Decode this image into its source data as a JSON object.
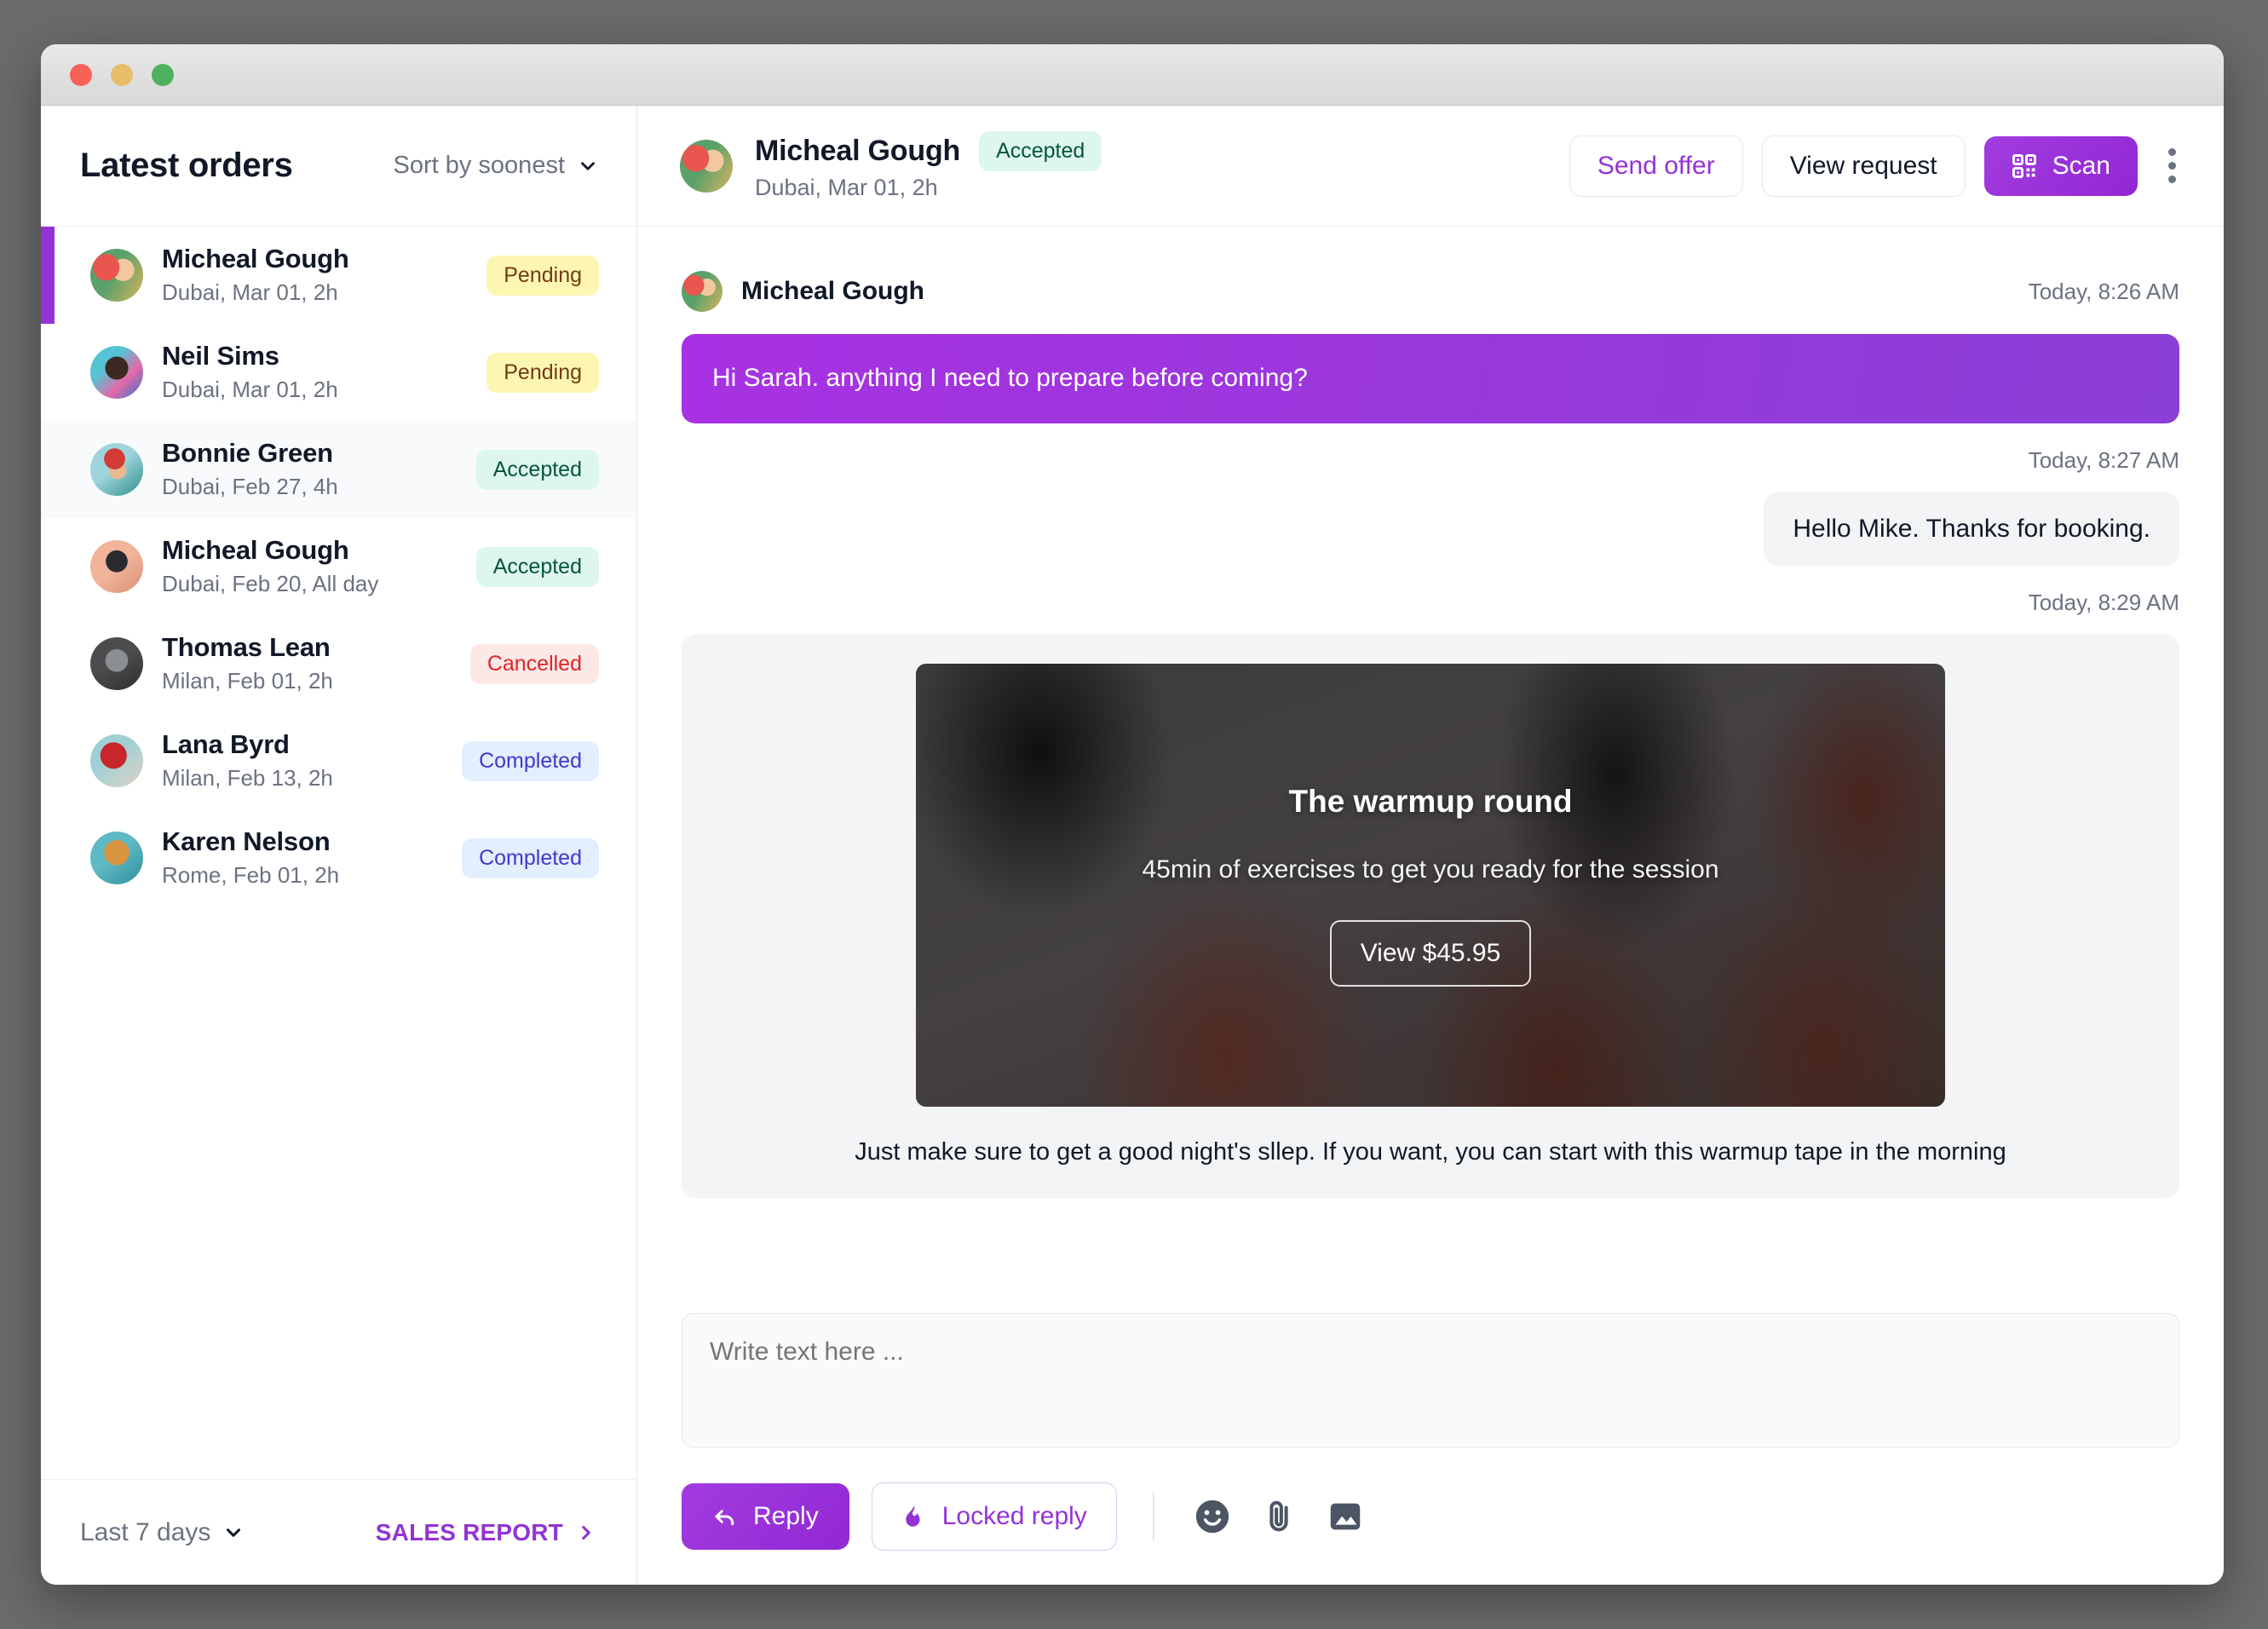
{
  "window": {
    "traffic_lights": [
      "close",
      "minimize",
      "maximize"
    ]
  },
  "sidebar": {
    "title": "Latest orders",
    "sort_label": "Sort by soonest",
    "orders": [
      {
        "name": "Micheal Gough",
        "meta": "Dubai, Mar 01, 2h",
        "status": "Pending",
        "status_kind": "pending",
        "selected": true,
        "highlight": false
      },
      {
        "name": "Neil Sims",
        "meta": "Dubai, Mar 01, 2h",
        "status": "Pending",
        "status_kind": "pending",
        "selected": false,
        "highlight": false
      },
      {
        "name": "Bonnie Green",
        "meta": "Dubai, Feb 27, 4h",
        "status": "Accepted",
        "status_kind": "accepted",
        "selected": false,
        "highlight": true
      },
      {
        "name": "Micheal Gough",
        "meta": "Dubai, Feb 20, All day",
        "status": "Accepted",
        "status_kind": "accepted",
        "selected": false,
        "highlight": false
      },
      {
        "name": "Thomas Lean",
        "meta": "Milan, Feb 01, 2h",
        "status": "Cancelled",
        "status_kind": "cancelled",
        "selected": false,
        "highlight": false
      },
      {
        "name": "Lana Byrd",
        "meta": "Milan, Feb 13, 2h",
        "status": "Completed",
        "status_kind": "completed",
        "selected": false,
        "highlight": false
      },
      {
        "name": "Karen Nelson",
        "meta": "Rome, Feb 01, 2h",
        "status": "Completed",
        "status_kind": "completed",
        "selected": false,
        "highlight": false
      }
    ],
    "footer": {
      "range_label": "Last 7 days",
      "sales_report_label": "SALES REPORT"
    }
  },
  "chat": {
    "header": {
      "name": "Micheal Gough",
      "meta": "Dubai, Mar 01, 2h",
      "status": "Accepted",
      "actions": {
        "send_offer": "Send offer",
        "view_request": "View request",
        "scan": "Scan",
        "scan_icon": "qr-code-icon",
        "more_icon": "kebab-menu-icon"
      }
    },
    "thread": {
      "sender_name": "Micheal Gough",
      "incoming_time": "Today, 8:26 AM",
      "incoming_text": "Hi Sarah. anything I need to prepare before coming?",
      "outgoing_time": "Today, 8:27 AM",
      "outgoing_text": "Hello Mike. Thanks for booking.",
      "card_time": "Today, 8:29 AM",
      "card": {
        "title": "The warmup round",
        "subtitle": "45min of exercises to get you ready for the session",
        "button": "View $45.95",
        "caption": "Just make sure to get a good night's sllep. If you want, you can start with this warmup tape in the morning"
      }
    },
    "composer": {
      "placeholder": "Write text here ...",
      "reply_label": "Reply",
      "locked_reply_label": "Locked reply",
      "reply_icon": "reply-arrow-icon",
      "locked_icon": "flame-icon",
      "emoji_icon": "emoji-smiley-icon",
      "attach_icon": "paperclip-icon",
      "image_icon": "image-icon"
    }
  },
  "colors": {
    "accent_purple": "#9333d6",
    "bubble_purple": "#a831e3",
    "badge_pending_bg": "#fdf6b2",
    "badge_accepted_bg": "#def7ec",
    "badge_cancelled_bg": "#fde8e8",
    "badge_completed_bg": "#e1effe"
  }
}
